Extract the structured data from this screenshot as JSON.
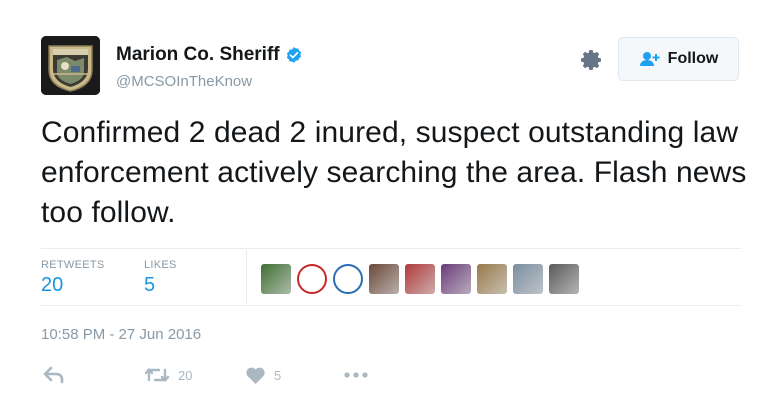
{
  "user": {
    "display_name": "Marion Co. Sheriff",
    "handle": "@MCSOInTheKnow",
    "verified": true
  },
  "header": {
    "follow_label": "Follow"
  },
  "tweet": {
    "text": "Confirmed 2 dead 2 inured, suspect outstanding law enforcement actively searching the area. Flash news too follow.",
    "timestamp": "10:58 PM - 27 Jun 2016"
  },
  "stats": {
    "retweets_label": "RETWEETS",
    "retweets_count": "20",
    "likes_label": "LIKES",
    "likes_count": "5"
  },
  "likers": [
    {
      "icon": "liker-avatar-group",
      "color": "#3f6f32"
    },
    {
      "icon": "liker-avatar-red-logo",
      "color": "#c62828"
    },
    {
      "icon": "liker-avatar-uas-drone",
      "color": "#2a6db4"
    },
    {
      "icon": "liker-avatar-person",
      "color": "#6b4a3a"
    },
    {
      "icon": "liker-avatar-person-red",
      "color": "#b03a3a"
    },
    {
      "icon": "liker-avatar-purple",
      "color": "#6a3c7a"
    },
    {
      "icon": "liker-avatar-landscape",
      "color": "#9a7a4a"
    },
    {
      "icon": "liker-avatar-sky",
      "color": "#7a8ea0"
    },
    {
      "icon": "liker-avatar-bw",
      "color": "#5a5a5a"
    }
  ],
  "actions": {
    "retweet_count": "20",
    "like_count": "5"
  },
  "colors": {
    "link_blue": "#1b95e0",
    "muted": "#8899a6",
    "icon_gray": "#aab8c2",
    "verified_blue": "#1da1f2"
  }
}
